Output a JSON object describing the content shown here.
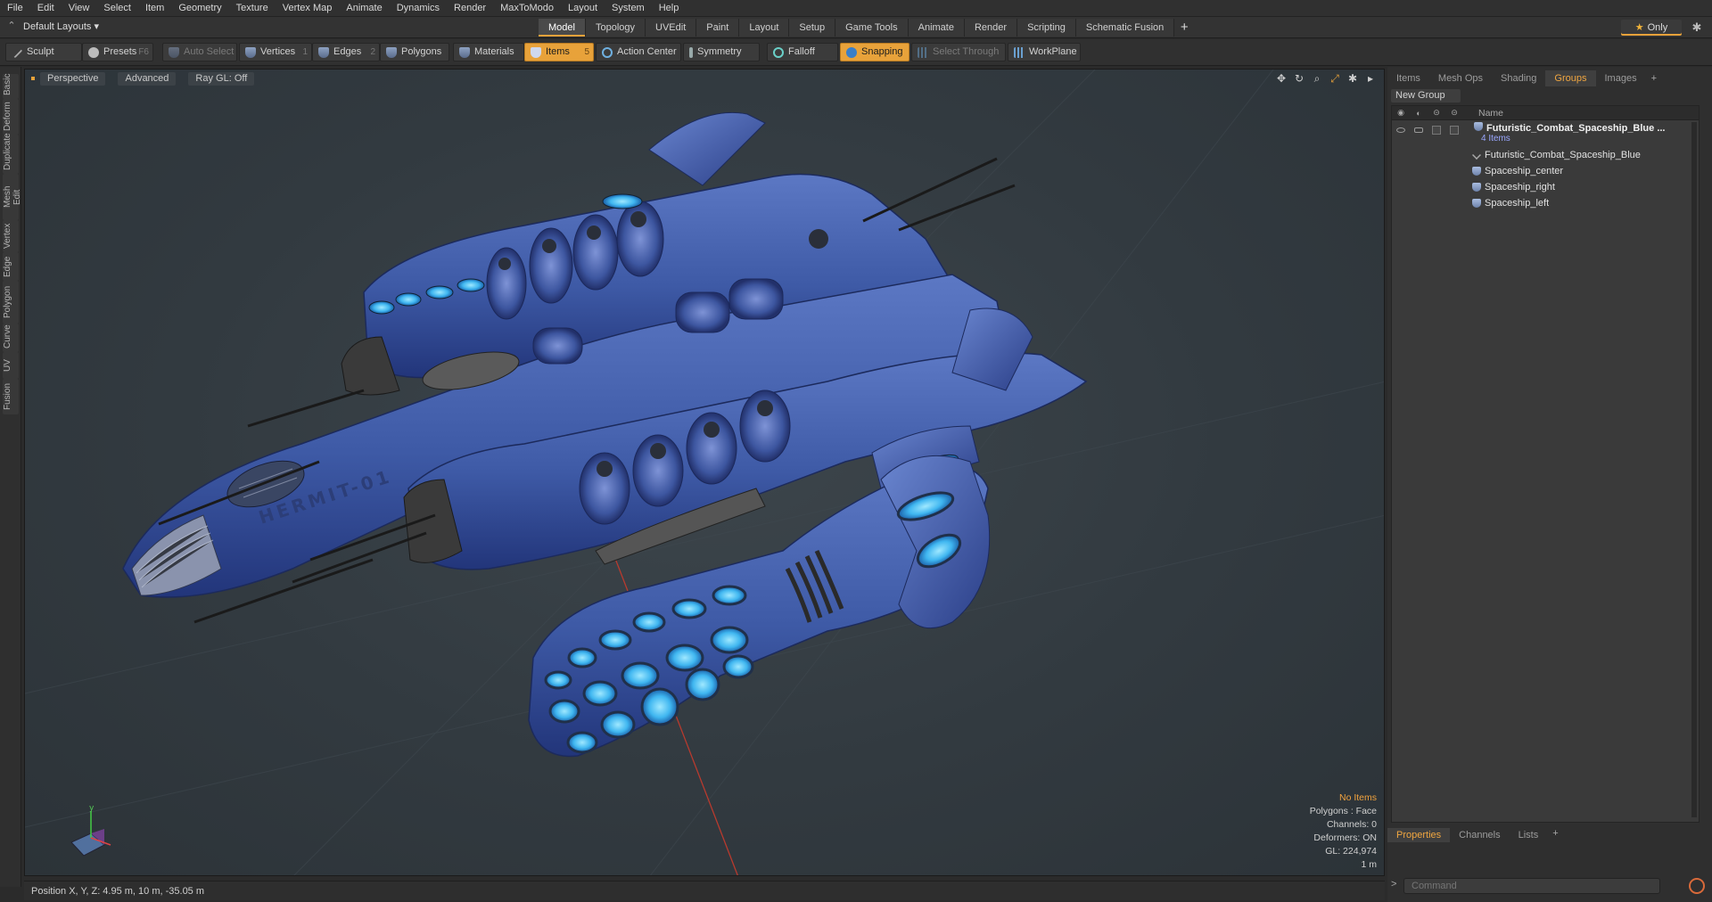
{
  "menu": [
    "File",
    "Edit",
    "View",
    "Select",
    "Item",
    "Geometry",
    "Texture",
    "Vertex Map",
    "Animate",
    "Dynamics",
    "Render",
    "MaxToModo",
    "Layout",
    "System",
    "Help"
  ],
  "layout_selector": "Default Layouts ▾",
  "layout_tabs": [
    {
      "label": "Model",
      "active": true
    },
    {
      "label": "Topology",
      "active": false
    },
    {
      "label": "UVEdit",
      "active": false
    },
    {
      "label": "Paint",
      "active": false
    },
    {
      "label": "Layout",
      "active": false
    },
    {
      "label": "Setup",
      "active": false
    },
    {
      "label": "Game Tools",
      "active": false
    },
    {
      "label": "Animate",
      "active": false
    },
    {
      "label": "Render",
      "active": false
    },
    {
      "label": "Scripting",
      "active": false
    },
    {
      "label": "Schematic Fusion",
      "active": false
    }
  ],
  "only_label": "Only",
  "toolbar": {
    "sculpt": "Sculpt",
    "presets": "Presets",
    "presets_key": "F6",
    "auto_select": "Auto Select",
    "vertices": "Vertices",
    "vertices_key": "1",
    "edges": "Edges",
    "edges_key": "2",
    "polygons": "Polygons",
    "materials": "Materials",
    "items": "Items",
    "items_key": "5",
    "action_center": "Action Center",
    "symmetry": "Symmetry",
    "falloff": "Falloff",
    "snapping": "Snapping",
    "select_through": "Select Through",
    "workplane": "WorkPlane"
  },
  "left_tabs": [
    "Basic",
    "Deform",
    "Duplicate",
    "Mesh Edit",
    "Vertex",
    "Edge",
    "Polygon",
    "Curve",
    "UV",
    "Fusion"
  ],
  "viewport": {
    "view": "Perspective",
    "shading": "Advanced",
    "raygl": "Ray GL: Off",
    "hull_text": "HERMIT-01",
    "info": {
      "no_items": "No Items",
      "polygons": "Polygons : Face",
      "channels": "Channels: 0",
      "deformers": "Deformers: ON",
      "gl": "GL: 224,974",
      "unit": "1 m"
    }
  },
  "status": {
    "position": "Position X, Y, Z:   4.95 m, 10 m, -35.05 m"
  },
  "right_panel": {
    "tabs": [
      {
        "label": "Items",
        "active": false
      },
      {
        "label": "Mesh Ops",
        "active": false
      },
      {
        "label": "Shading",
        "active": false
      },
      {
        "label": "Groups",
        "active": true
      },
      {
        "label": "Images",
        "active": false
      }
    ],
    "new_group": "New Group",
    "column_name": "Name",
    "group": {
      "name": "Futuristic_Combat_Spaceship_Blue ...",
      "count": "4 Items",
      "children": [
        {
          "name": "Futuristic_Combat_Spaceship_Blue",
          "icon": "locator-icon"
        },
        {
          "name": "Spaceship_center",
          "icon": "mesh-icon"
        },
        {
          "name": "Spaceship_right",
          "icon": "mesh-icon"
        },
        {
          "name": "Spaceship_left",
          "icon": "mesh-icon"
        }
      ]
    },
    "bottom_tabs": [
      {
        "label": "Properties",
        "active": true
      },
      {
        "label": "Channels",
        "active": false
      },
      {
        "label": "Lists",
        "active": false
      }
    ],
    "command_placeholder": "Command"
  },
  "colors": {
    "accent": "#e8a23a",
    "hull": "#3f5da8",
    "glow": "#4fc3ff"
  }
}
